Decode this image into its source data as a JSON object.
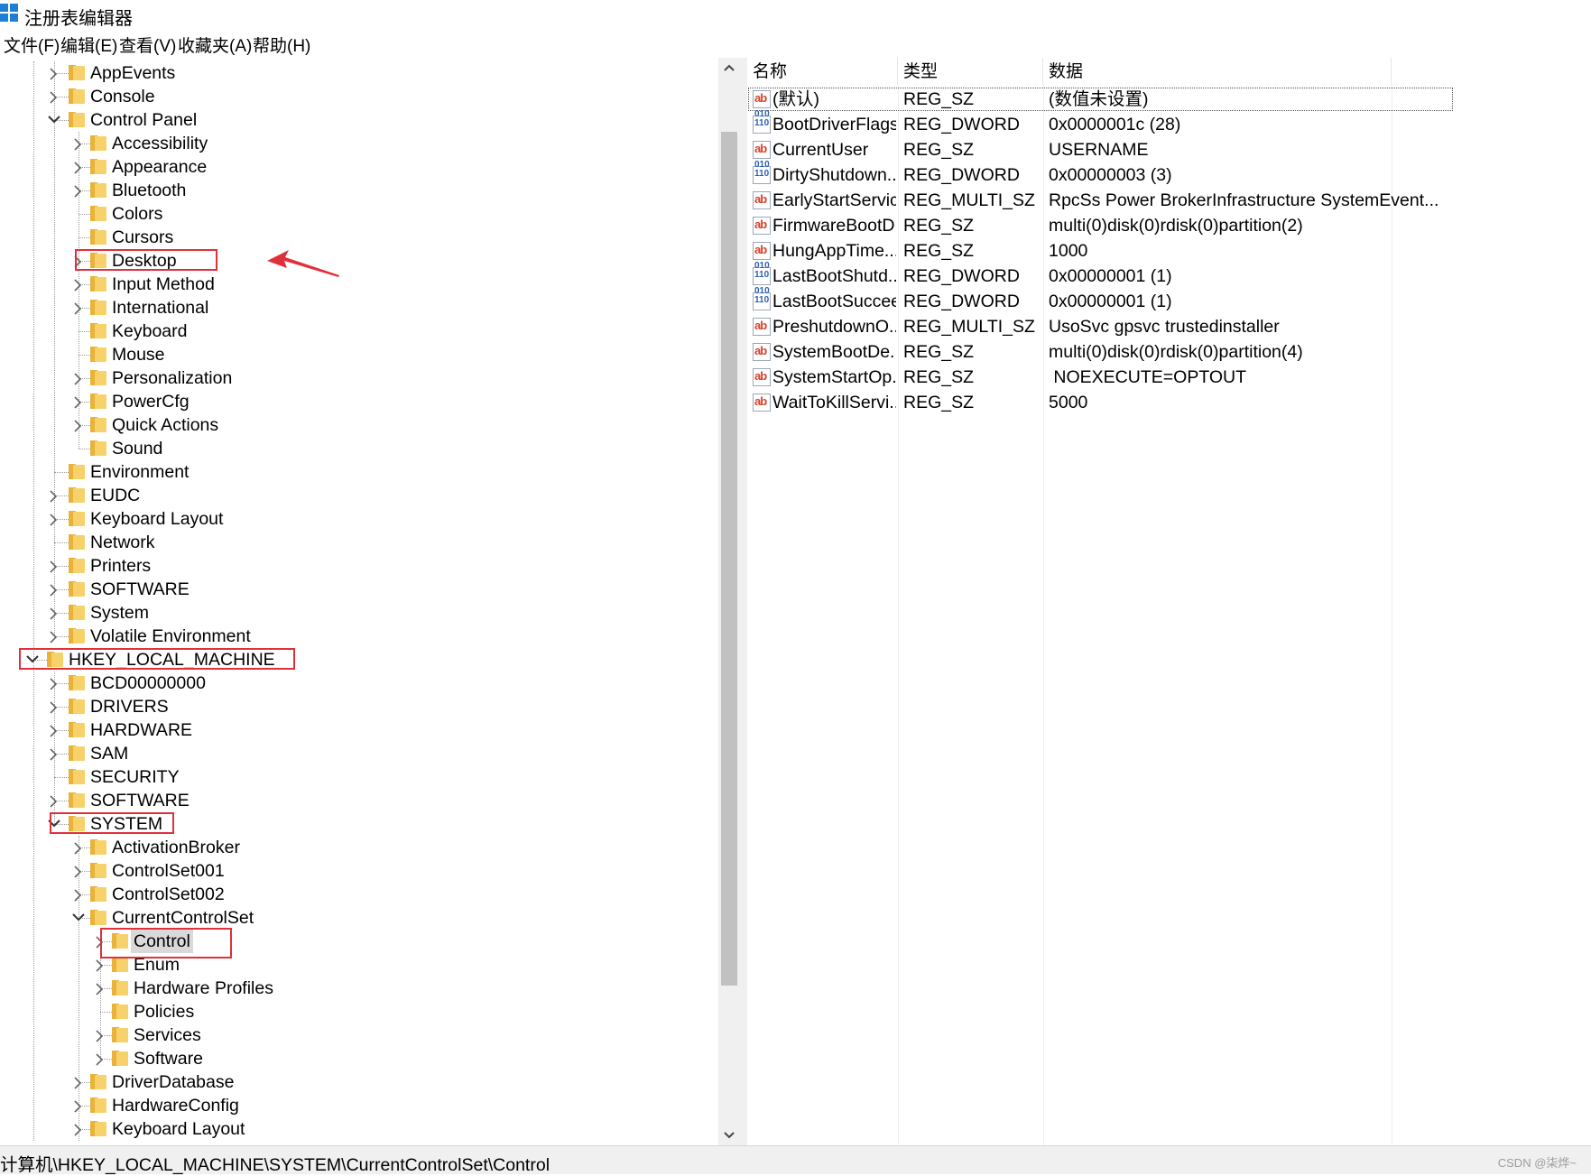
{
  "window": {
    "title": "注册表编辑器"
  },
  "menu": [
    "文件(F)",
    "编辑(E)",
    "查看(V)",
    "收藏夹(A)",
    "帮助(H)"
  ],
  "tree": [
    {
      "label": "AppEvents",
      "level": 2,
      "expander": "collapsed"
    },
    {
      "label": "Console",
      "level": 2,
      "expander": "collapsed"
    },
    {
      "label": "Control Panel",
      "level": 2,
      "expander": "expanded"
    },
    {
      "label": "Accessibility",
      "level": 3,
      "expander": "collapsed"
    },
    {
      "label": "Appearance",
      "level": 3,
      "expander": "collapsed"
    },
    {
      "label": "Bluetooth",
      "level": 3,
      "expander": "collapsed"
    },
    {
      "label": "Colors",
      "level": 3,
      "expander": "none"
    },
    {
      "label": "Cursors",
      "level": 3,
      "expander": "none"
    },
    {
      "label": "Desktop",
      "level": 3,
      "expander": "collapsed",
      "highlight": true
    },
    {
      "label": "Input Method",
      "level": 3,
      "expander": "collapsed"
    },
    {
      "label": "International",
      "level": 3,
      "expander": "collapsed"
    },
    {
      "label": "Keyboard",
      "level": 3,
      "expander": "none"
    },
    {
      "label": "Mouse",
      "level": 3,
      "expander": "none"
    },
    {
      "label": "Personalization",
      "level": 3,
      "expander": "collapsed"
    },
    {
      "label": "PowerCfg",
      "level": 3,
      "expander": "collapsed"
    },
    {
      "label": "Quick Actions",
      "level": 3,
      "expander": "collapsed"
    },
    {
      "label": "Sound",
      "level": 3,
      "expander": "none"
    },
    {
      "label": "Environment",
      "level": 2,
      "expander": "none"
    },
    {
      "label": "EUDC",
      "level": 2,
      "expander": "collapsed"
    },
    {
      "label": "Keyboard Layout",
      "level": 2,
      "expander": "collapsed"
    },
    {
      "label": "Network",
      "level": 2,
      "expander": "none"
    },
    {
      "label": "Printers",
      "level": 2,
      "expander": "collapsed"
    },
    {
      "label": "SOFTWARE",
      "level": 2,
      "expander": "collapsed"
    },
    {
      "label": "System",
      "level": 2,
      "expander": "collapsed"
    },
    {
      "label": "Volatile Environment",
      "level": 2,
      "expander": "collapsed"
    },
    {
      "label": "HKEY_LOCAL_MACHINE",
      "level": 1,
      "expander": "expanded",
      "highlight": true
    },
    {
      "label": "BCD00000000",
      "level": 2,
      "expander": "collapsed"
    },
    {
      "label": "DRIVERS",
      "level": 2,
      "expander": "collapsed"
    },
    {
      "label": "HARDWARE",
      "level": 2,
      "expander": "collapsed"
    },
    {
      "label": "SAM",
      "level": 2,
      "expander": "collapsed"
    },
    {
      "label": "SECURITY",
      "level": 2,
      "expander": "none"
    },
    {
      "label": "SOFTWARE",
      "level": 2,
      "expander": "collapsed"
    },
    {
      "label": "SYSTEM",
      "level": 2,
      "expander": "expanded",
      "highlight": true
    },
    {
      "label": "ActivationBroker",
      "level": 3,
      "expander": "collapsed"
    },
    {
      "label": "ControlSet001",
      "level": 3,
      "expander": "collapsed"
    },
    {
      "label": "ControlSet002",
      "level": 3,
      "expander": "collapsed"
    },
    {
      "label": "CurrentControlSet",
      "level": 3,
      "expander": "expanded"
    },
    {
      "label": "Control",
      "level": 4,
      "expander": "collapsed",
      "highlight": true,
      "selected": true
    },
    {
      "label": "Enum",
      "level": 4,
      "expander": "collapsed"
    },
    {
      "label": "Hardware Profiles",
      "level": 4,
      "expander": "collapsed"
    },
    {
      "label": "Policies",
      "level": 4,
      "expander": "none"
    },
    {
      "label": "Services",
      "level": 4,
      "expander": "collapsed"
    },
    {
      "label": "Software",
      "level": 4,
      "expander": "collapsed"
    },
    {
      "label": "DriverDatabase",
      "level": 3,
      "expander": "collapsed"
    },
    {
      "label": "HardwareConfig",
      "level": 3,
      "expander": "collapsed"
    },
    {
      "label": "Keyboard Layout",
      "level": 3,
      "expander": "collapsed"
    }
  ],
  "list": {
    "columns": [
      "名称",
      "类型",
      "数据"
    ],
    "rows": [
      {
        "icon": "string-value-icon",
        "name": "(默认)",
        "type": "REG_SZ",
        "data": "(数值未设置)",
        "focused": true
      },
      {
        "icon": "binary-value-icon",
        "name": "BootDriverFlags",
        "type": "REG_DWORD",
        "data": "0x0000001c (28)"
      },
      {
        "icon": "string-value-icon",
        "name": "CurrentUser",
        "type": "REG_SZ",
        "data": "USERNAME"
      },
      {
        "icon": "binary-value-icon",
        "name": "DirtyShutdown...",
        "type": "REG_DWORD",
        "data": "0x00000003 (3)"
      },
      {
        "icon": "string-value-icon",
        "name": "EarlyStartServic...",
        "type": "REG_MULTI_SZ",
        "data": "RpcSs Power BrokerInfrastructure SystemEvent..."
      },
      {
        "icon": "string-value-icon",
        "name": "FirmwareBootD...",
        "type": "REG_SZ",
        "data": "multi(0)disk(0)rdisk(0)partition(2)"
      },
      {
        "icon": "string-value-icon",
        "name": "HungAppTime...",
        "type": "REG_SZ",
        "data": "1000"
      },
      {
        "icon": "binary-value-icon",
        "name": "LastBootShutd...",
        "type": "REG_DWORD",
        "data": "0x00000001 (1)"
      },
      {
        "icon": "binary-value-icon",
        "name": "LastBootSuccee...",
        "type": "REG_DWORD",
        "data": "0x00000001 (1)"
      },
      {
        "icon": "string-value-icon",
        "name": "PreshutdownO...",
        "type": "REG_MULTI_SZ",
        "data": "UsoSvc gpsvc trustedinstaller"
      },
      {
        "icon": "string-value-icon",
        "name": "SystemBootDe...",
        "type": "REG_SZ",
        "data": "multi(0)disk(0)rdisk(0)partition(4)"
      },
      {
        "icon": "string-value-icon",
        "name": "SystemStartOp...",
        "type": "REG_SZ",
        "data": " NOEXECUTE=OPTOUT"
      },
      {
        "icon": "string-value-icon",
        "name": "WaitToKillServi...",
        "type": "REG_SZ",
        "data": "5000"
      }
    ]
  },
  "status": {
    "path": "计算机\\HKEY_LOCAL_MACHINE\\SYSTEM\\CurrentControlSet\\Control",
    "watermark": "CSDN @柒烨~"
  },
  "colors": {
    "highlight": "#e0303a",
    "folder": "#f7d26a",
    "accent": "#1e7fd6"
  }
}
